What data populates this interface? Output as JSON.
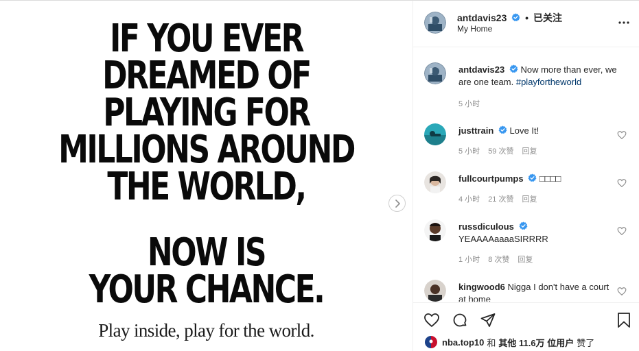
{
  "poster": {
    "lines": [
      "IF YOU EVER",
      "DREAMED OF",
      "PLAYING FOR",
      "MILLIONS AROUND",
      "THE WORLD,",
      "NOW IS",
      "YOUR CHANCE."
    ],
    "tagline": "Play inside, play for the world."
  },
  "header": {
    "username": "antdavis23",
    "separator": "•",
    "follow_status": "已关注",
    "location": "My Home"
  },
  "caption": {
    "username": "antdavis23",
    "text": "Now more than ever, we are one team.",
    "hashtag": "#playfortheworld",
    "time": "5 小时"
  },
  "comments": [
    {
      "username": "justtrain",
      "text": "Love It!",
      "time": "5 小时",
      "likes": "59 次赞",
      "reply": "回复"
    },
    {
      "username": "fullcourtpumps",
      "text": "□□□□",
      "time": "4 小时",
      "likes": "21 次赞",
      "reply": "回复"
    },
    {
      "username": "russdiculous",
      "text": "YEAAAAaaaaSIRRRR",
      "time": "1 小时",
      "likes": "8 次赞",
      "reply": "回复"
    },
    {
      "username": "kingwood6",
      "text": "Nigga I don't have a court at home",
      "time": "",
      "likes": "",
      "reply": ""
    }
  ],
  "likes_bar": {
    "user": "nba.top10",
    "rest_prefix": "和",
    "rest_bold": "其他 11.6万 位用户",
    "rest_suffix": "赞了"
  },
  "colors": {
    "verified": "#3897f0",
    "link": "#00376b",
    "muted": "#8e8e8e",
    "border": "#efefef"
  },
  "icons": [
    "chevron-right-icon",
    "verified-icon",
    "more-icon",
    "heart-icon",
    "comment-icon",
    "share-icon",
    "bookmark-icon"
  ]
}
